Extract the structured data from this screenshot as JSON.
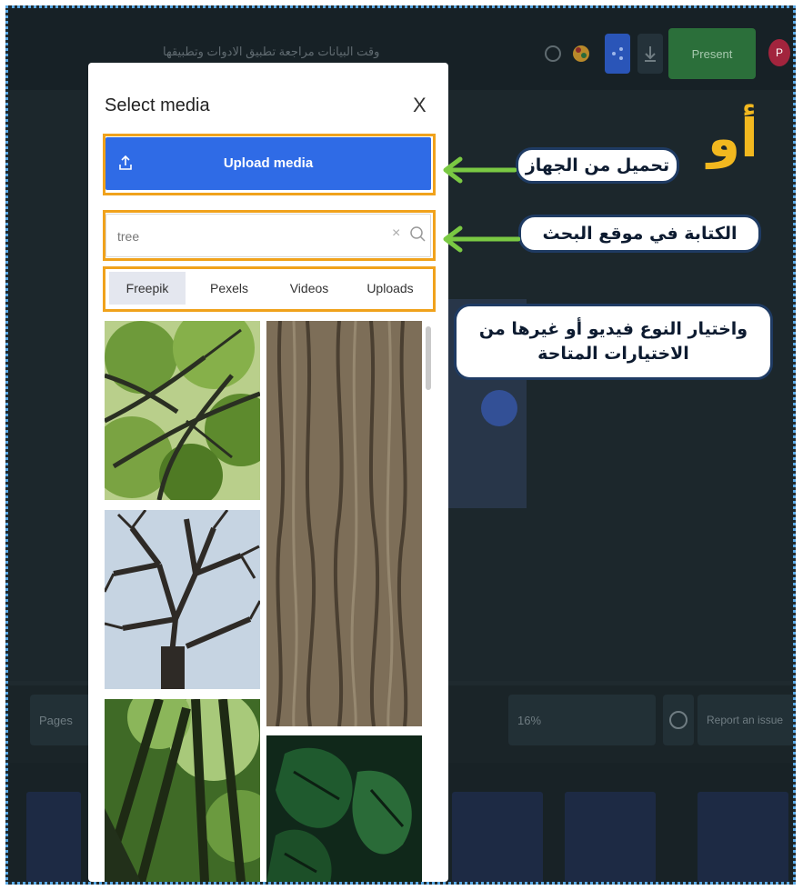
{
  "app": {
    "document_title": "وقت البيانات مراجعة تطبيق الادوات وتطبيقها",
    "present_label": "Present",
    "avatar_initial": "P"
  },
  "bottom_bar": {
    "pages_label": "Pages",
    "zoom_label": "16%",
    "report_label": "Report an issue"
  },
  "modal": {
    "title": "Select media",
    "close_label": "X",
    "upload_label": "Upload media",
    "search": {
      "value": "tree",
      "placeholder": "Search",
      "clear_label": "×"
    },
    "tabs": [
      {
        "label": "Freepik",
        "active": true
      },
      {
        "label": "Pexels",
        "active": false
      },
      {
        "label": "Videos",
        "active": false
      },
      {
        "label": "Uploads",
        "active": false
      }
    ]
  },
  "annotations": {
    "or_label": "أو",
    "upload_callout": "تحميل من الجهاز",
    "search_callout": "الكتابة في موقع البحث",
    "tabs_callout": "واختيار النوع فيديو أو غيرها من الاختيارات المتاحة"
  },
  "colors": {
    "highlight": "#f0a21c",
    "upload_button": "#2f6be6",
    "arrow": "#7ac943",
    "or_label": "#f2b81f"
  }
}
